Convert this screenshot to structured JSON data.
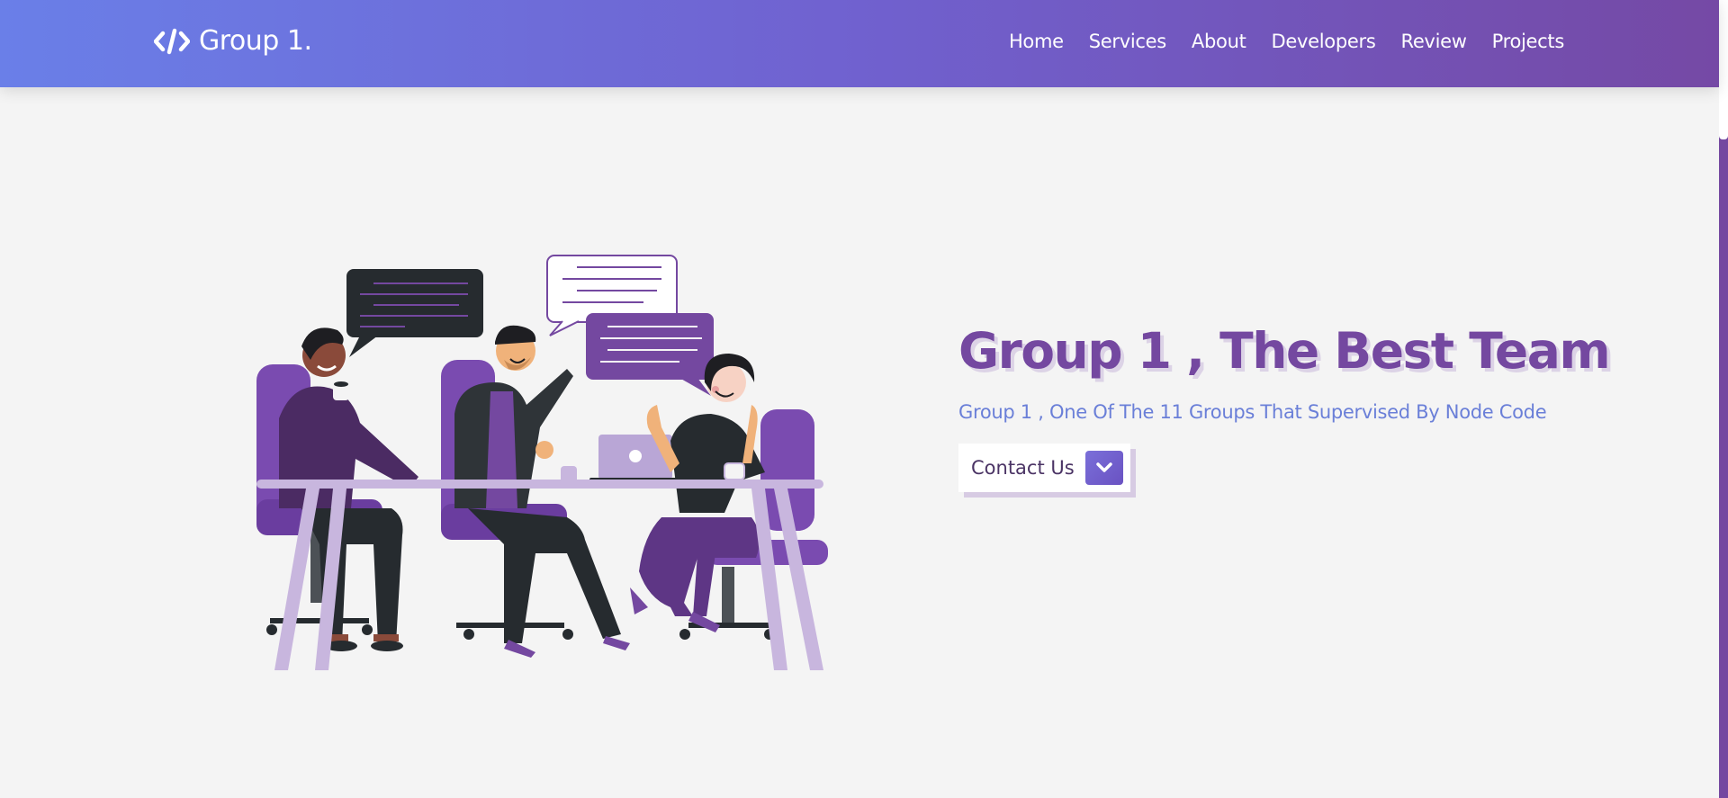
{
  "header": {
    "logo_text": "Group 1.",
    "nav": [
      "Home",
      "Services",
      "About",
      "Developers",
      "Review",
      "Projects"
    ]
  },
  "hero": {
    "title": "Group 1 , The Best Team",
    "subtitle": "Group 1 , One Of The 11 Groups That Supervised By Node Code",
    "cta_label": "Contact Us",
    "cta_icon": "chevron-down-icon",
    "illustration": "team-meeting-illustration"
  },
  "colors": {
    "header_gradient_start": "#6a7fe8",
    "header_gradient_end": "#7549a5",
    "title": "#7448a0",
    "subtitle": "#6a7fd8",
    "background": "#f4f4f4",
    "accent": "#7448a0"
  },
  "icons": {
    "logo": "code-icon"
  }
}
